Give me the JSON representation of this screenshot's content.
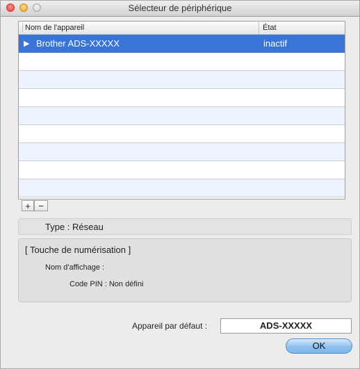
{
  "window": {
    "title": "Sélecteur de périphérique"
  },
  "table": {
    "col_name": "Nom de l'appareil",
    "col_state": "État",
    "rows": [
      {
        "expand_icon": "triangle-right-icon",
        "expand_glyph": "▶",
        "name": "Brother ADS-XXXXX",
        "state": "inactif",
        "selected": true
      }
    ]
  },
  "buttons": {
    "add": "+",
    "remove": "−",
    "ok": "OK"
  },
  "info": {
    "type_label": "Type : Réseau",
    "scan_title": "[ Touche de numérisation ]",
    "display_name": "Nom d'affichage :",
    "pin": "Code PIN : Non défini"
  },
  "default_device": {
    "label": "Appareil par défaut :",
    "value": "ADS-XXXXX"
  },
  "colors": {
    "selection": "#3875d7",
    "alt_row": "#edf3fe",
    "ok_button": "#8fc0ee"
  }
}
